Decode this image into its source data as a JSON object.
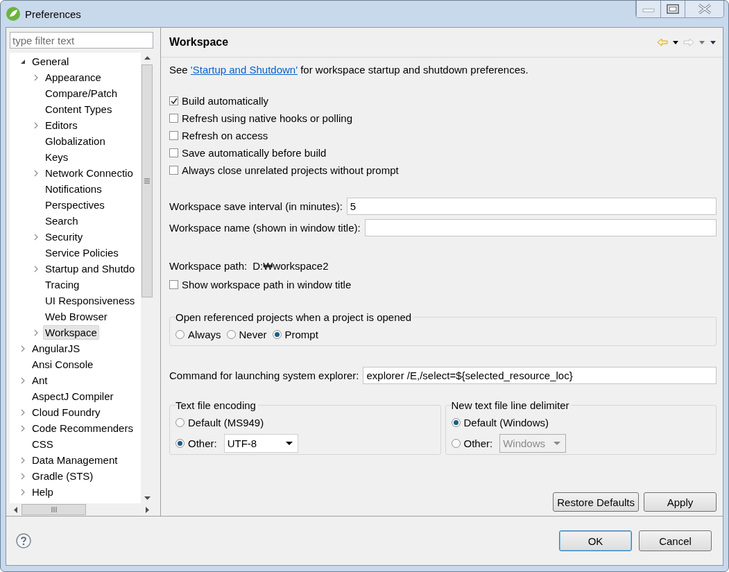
{
  "window": {
    "title": "Preferences"
  },
  "filter": {
    "placeholder": "type filter text"
  },
  "tree": [
    {
      "label": "General",
      "expandable": true,
      "expanded": true,
      "selected": false,
      "children": [
        {
          "label": "Appearance",
          "expandable": true,
          "expanded": false,
          "selected": false
        },
        {
          "label": "Compare/Patch",
          "expandable": false,
          "selected": false
        },
        {
          "label": "Content Types",
          "expandable": false,
          "selected": false
        },
        {
          "label": "Editors",
          "expandable": true,
          "expanded": false,
          "selected": false
        },
        {
          "label": "Globalization",
          "expandable": false,
          "selected": false
        },
        {
          "label": "Keys",
          "expandable": false,
          "selected": false
        },
        {
          "label": "Network Connectio",
          "expandable": true,
          "expanded": false,
          "selected": false
        },
        {
          "label": "Notifications",
          "expandable": false,
          "selected": false
        },
        {
          "label": "Perspectives",
          "expandable": false,
          "selected": false
        },
        {
          "label": "Search",
          "expandable": false,
          "selected": false
        },
        {
          "label": "Security",
          "expandable": true,
          "expanded": false,
          "selected": false
        },
        {
          "label": "Service Policies",
          "expandable": false,
          "selected": false
        },
        {
          "label": "Startup and Shutdo",
          "expandable": true,
          "expanded": false,
          "selected": false
        },
        {
          "label": "Tracing",
          "expandable": false,
          "selected": false
        },
        {
          "label": "UI Responsiveness",
          "expandable": false,
          "selected": false
        },
        {
          "label": "Web Browser",
          "expandable": false,
          "selected": false
        },
        {
          "label": "Workspace",
          "expandable": true,
          "expanded": false,
          "selected": true
        }
      ]
    },
    {
      "label": "AngularJS",
      "expandable": true,
      "expanded": false,
      "selected": false
    },
    {
      "label": "Ansi Console",
      "expandable": false,
      "selected": false
    },
    {
      "label": "Ant",
      "expandable": true,
      "expanded": false,
      "selected": false
    },
    {
      "label": "AspectJ Compiler",
      "expandable": false,
      "selected": false
    },
    {
      "label": "Cloud Foundry",
      "expandable": true,
      "expanded": false,
      "selected": false
    },
    {
      "label": "Code Recommenders",
      "expandable": true,
      "expanded": false,
      "selected": false
    },
    {
      "label": "CSS",
      "expandable": false,
      "selected": false
    },
    {
      "label": "Data Management",
      "expandable": true,
      "expanded": false,
      "selected": false
    },
    {
      "label": "Gradle (STS)",
      "expandable": true,
      "expanded": false,
      "selected": false
    },
    {
      "label": "Help",
      "expandable": true,
      "expanded": false,
      "selected": false
    }
  ],
  "page": {
    "title": "Workspace",
    "intro": {
      "before": "See ",
      "link": "'Startup and Shutdown'",
      "after": " for workspace startup and shutdown preferences."
    },
    "checkboxes": [
      {
        "label": "Build automatically",
        "checked": true
      },
      {
        "label": "Refresh using native hooks or polling",
        "checked": false
      },
      {
        "label": "Refresh on access",
        "checked": false
      },
      {
        "label": "Save automatically before build",
        "checked": false
      },
      {
        "label": "Always close unrelated projects without prompt",
        "checked": false
      }
    ],
    "fields": [
      {
        "label": "Workspace save interval (in minutes):",
        "value": "5"
      },
      {
        "label": "Workspace name (shown in window title):"
      }
    ],
    "workspace_path": {
      "label": "Workspace path:",
      "value": "D:₩workspace2"
    },
    "path_checkbox": {
      "label": "Show workspace path in window title",
      "checked": false
    },
    "open_group": {
      "title": "Open referenced projects when a project is opened",
      "options": [
        {
          "label": "Always",
          "selected": false
        },
        {
          "label": "Never",
          "selected": false
        },
        {
          "label": "Prompt",
          "selected": true
        }
      ]
    },
    "command_field": {
      "label": "Command for launching system explorer:",
      "value": "explorer /E,/select=${selected_resource_loc}"
    },
    "encoding_group": {
      "title": "Text file encoding",
      "options": [
        {
          "label": "Default (MS949)",
          "selected": false
        },
        {
          "label": "Other:",
          "selected": true,
          "combo": {
            "value": "UTF-8",
            "disabled": false
          }
        }
      ]
    },
    "delimiter_group": {
      "title": "New text file line delimiter",
      "options": [
        {
          "label": "Default (Windows)",
          "selected": true
        },
        {
          "label": "Other:",
          "selected": false,
          "combo": {
            "value": "Windows",
            "disabled": true
          }
        }
      ]
    },
    "buttons": [
      "Restore Defaults",
      "Apply"
    ]
  },
  "dialog_buttons": [
    {
      "label": "OK",
      "default": true
    },
    {
      "label": "Cancel",
      "default": false
    }
  ]
}
